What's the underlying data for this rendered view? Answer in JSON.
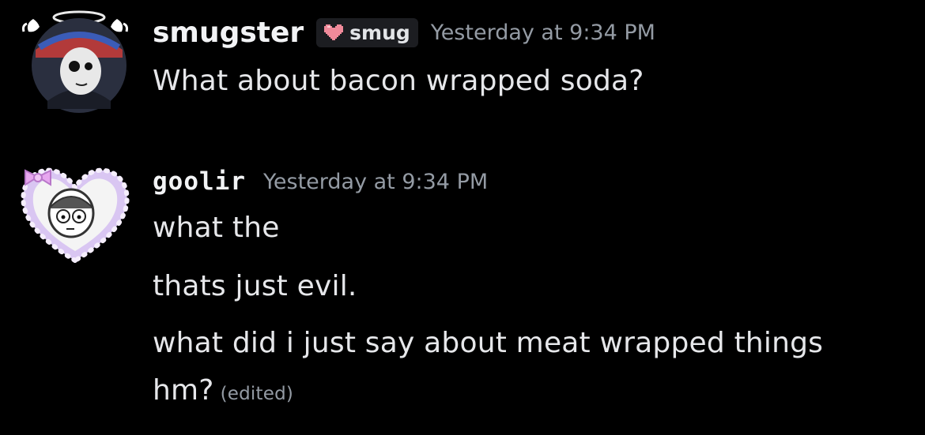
{
  "messages": [
    {
      "author": "smugster",
      "tag": {
        "label": "smug",
        "icon": "pixel-heart-icon",
        "icon_color": "#f08a9a"
      },
      "timestamp": "Yesterday at 9:34 PM",
      "lines": [
        "What about bacon wrapped soda?"
      ],
      "avatar": "avatar-with-halo-and-wings"
    },
    {
      "author": "goolir",
      "timestamp": "Yesterday at 9:34 PM",
      "lines": [
        "what the",
        "thats just evil.",
        "what did i just say about meat wrapped things",
        "hm?"
      ],
      "edited_label": "(edited)",
      "avatar": "avatar-with-heart-frame-and-bow"
    }
  ],
  "colors": {
    "background": "#000000",
    "username": "#f2f3f5",
    "timestamp": "#949ba4",
    "message_text": "#e6e7ea",
    "tag_background": "#1c1d21",
    "frame_lilac": "#d9c6f2",
    "bow_pink": "#e7a6ef"
  }
}
